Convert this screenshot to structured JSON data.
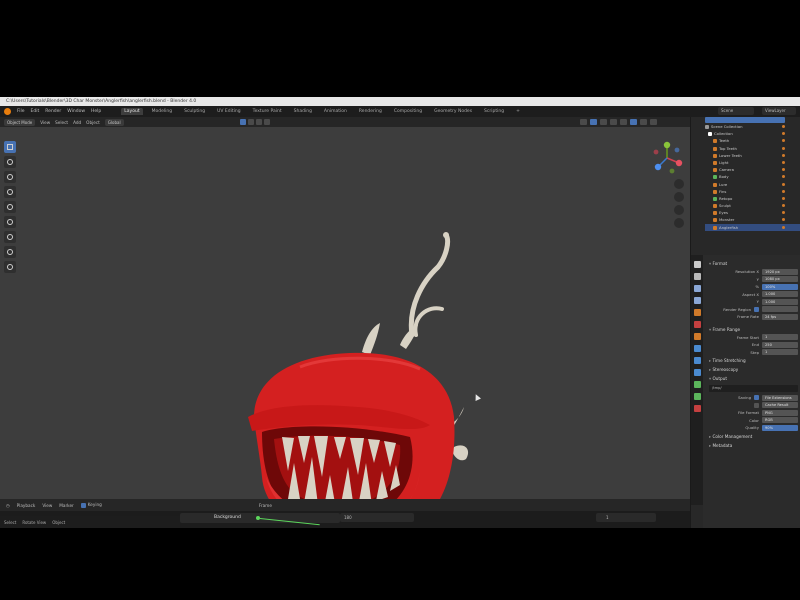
{
  "window": {
    "title": "C:\\Users\\Tutorials\\Blender\\3D Char Monster\\Anglerfish\\anglerfish.blend - Blender 4.0"
  },
  "menu": [
    "File",
    "Edit",
    "Render",
    "Window",
    "Help"
  ],
  "workspace_tabs": [
    {
      "label": "Layout",
      "active": true
    },
    {
      "label": "Modeling",
      "active": false
    },
    {
      "label": "Sculpting",
      "active": false
    },
    {
      "label": "UV Editing",
      "active": false
    },
    {
      "label": "Texture Paint",
      "active": false
    },
    {
      "label": "Shading",
      "active": false
    },
    {
      "label": "Animation",
      "active": false
    },
    {
      "label": "Rendering",
      "active": false
    },
    {
      "label": "Compositing",
      "active": false
    },
    {
      "label": "Geometry Nodes",
      "active": false
    },
    {
      "label": "Scripting",
      "active": false
    },
    {
      "label": "+",
      "active": false
    }
  ],
  "scene": {
    "name": "Scene",
    "view_layer": "ViewLayer"
  },
  "viewport_header": {
    "mode": "Object Mode",
    "menus": [
      "View",
      "Select",
      "Add",
      "Object"
    ],
    "orientation": "Global"
  },
  "outliner": {
    "rows": [
      {
        "label": "Scene Collection",
        "color": "#9a9a9a",
        "selected": false
      },
      {
        "label": "Collection",
        "color": "#ffffff",
        "selected": false
      },
      {
        "label": "Teeth",
        "color": "#d07a2a",
        "selected": false
      },
      {
        "label": "Top Teeth",
        "color": "#d07a2a",
        "selected": false
      },
      {
        "label": "Lower Teeth",
        "color": "#d07a2a",
        "selected": false
      },
      {
        "label": "Light",
        "color": "#d07a2a",
        "selected": false
      },
      {
        "label": "Camera",
        "color": "#d07a2a",
        "selected": false
      },
      {
        "label": "Body",
        "color": "#5bb55b",
        "selected": false
      },
      {
        "label": "Lure",
        "color": "#d07a2a",
        "selected": false
      },
      {
        "label": "Fins",
        "color": "#d07a2a",
        "selected": false
      },
      {
        "label": "Retopo",
        "color": "#5bb55b",
        "selected": false
      },
      {
        "label": "Sculpt",
        "color": "#d07a2a",
        "selected": false
      },
      {
        "label": "Eyes",
        "color": "#d07a2a",
        "selected": false
      },
      {
        "label": "Monster",
        "color": "#d07a2a",
        "selected": false
      },
      {
        "label": "Anglerfish",
        "color": "#d07a2a",
        "selected": true
      }
    ]
  },
  "properties": {
    "format_header": "Format",
    "format_rows": [
      {
        "label": "Resolution X",
        "value": "1920 px",
        "blue": false
      },
      {
        "label": "Y",
        "value": "1080 px",
        "blue": false
      },
      {
        "label": "%",
        "value": "100%",
        "blue": true
      },
      {
        "label": "Aspect X",
        "value": "1.000",
        "blue": false
      },
      {
        "label": "Y",
        "value": "1.000",
        "blue": false
      },
      {
        "label": "Render Region",
        "value": "",
        "checkbox": true
      },
      {
        "label": "Frame Rate",
        "value": "24 fps",
        "blue": false
      }
    ],
    "frame_range_header": "Frame Range",
    "frame_range_rows": [
      {
        "label": "Frame Start",
        "value": "1"
      },
      {
        "label": "End",
        "value": "250"
      },
      {
        "label": "Step",
        "value": "1"
      }
    ],
    "time_stretching": "Time Stretching",
    "stereoscopy": "Stereoscopy",
    "output_header": "Output",
    "output_path": "/tmp/",
    "output_rows": [
      {
        "label": "Saving",
        "value": "File Extensions",
        "checkbox": true
      },
      {
        "label": "",
        "value": "Cache Result",
        "checkbox": false
      },
      {
        "label": "File Format",
        "value": "PNG"
      },
      {
        "label": "Color",
        "value": "RGB"
      },
      {
        "label": "Quality",
        "value": "90%",
        "blue": true
      }
    ],
    "color_management": "Color Management",
    "metadata": "Metadata"
  },
  "timeline": {
    "menus": [
      "Playback",
      "View",
      "Marker"
    ],
    "keying_label": "Keying",
    "frame_label": "Frame",
    "node_label": "Background",
    "range": "180",
    "current": "1"
  },
  "statusbar": [
    "Select",
    "Rotate View",
    "Object"
  ],
  "colors": {
    "accent": "#4772b3",
    "monster_red": "#d42020",
    "teeth": "#d8d2c4",
    "viewport_bg": "#3d3d3d"
  }
}
